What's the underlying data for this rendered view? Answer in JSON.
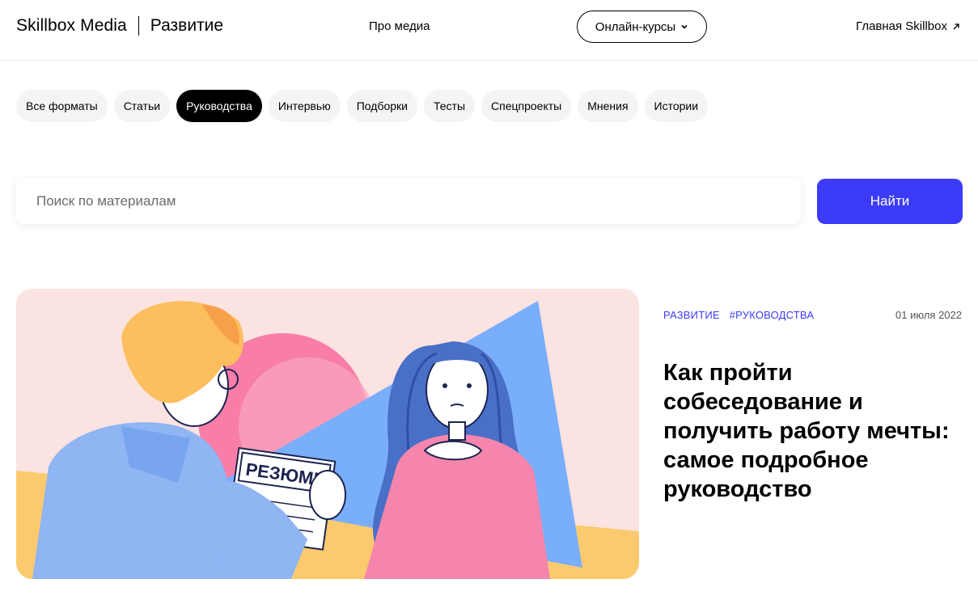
{
  "header": {
    "brand": "Skillbox Media",
    "section": "Развитие",
    "nav_about": "Про медиа",
    "courses_label": "Онлайн-курсы",
    "main_link": "Главная Skillbox"
  },
  "formats": [
    {
      "label": "Все форматы",
      "active": false
    },
    {
      "label": "Статьи",
      "active": false
    },
    {
      "label": "Руководства",
      "active": true
    },
    {
      "label": "Интервью",
      "active": false
    },
    {
      "label": "Подборки",
      "active": false
    },
    {
      "label": "Тесты",
      "active": false
    },
    {
      "label": "Спецпроекты",
      "active": false
    },
    {
      "label": "Мнения",
      "active": false
    },
    {
      "label": "Истории",
      "active": false
    }
  ],
  "search": {
    "placeholder": "Поиск по материалам",
    "button_label": "Найти"
  },
  "article": {
    "tags": [
      "РАЗВИТИЕ",
      "#РУКОВОДСТВА"
    ],
    "date": "01 июля 2022",
    "title": "Как пройти собеседование и получить работу мечты: самое подробное руководство",
    "image_text": "РЕЗЮМЕ"
  },
  "colors": {
    "accent": "#3b3bf8",
    "active_pill": "#000000",
    "pill_bg": "#f4f4f4"
  }
}
